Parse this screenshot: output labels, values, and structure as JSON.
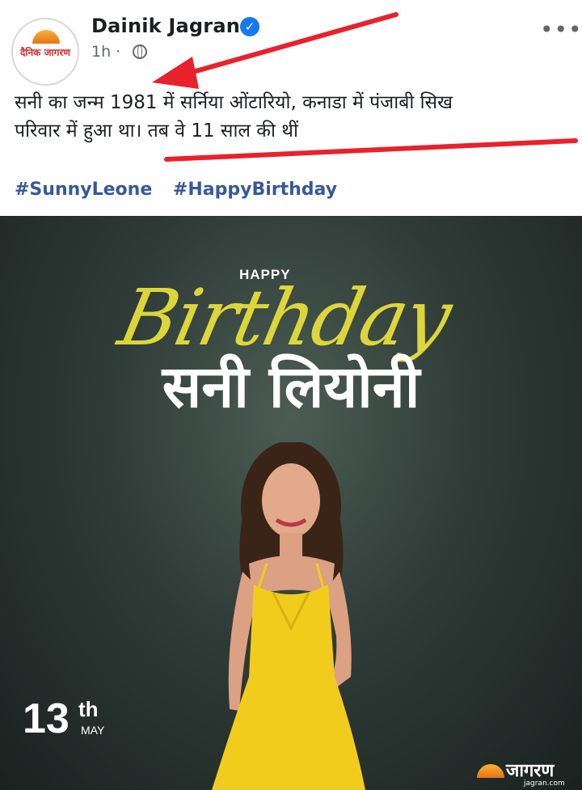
{
  "header": {
    "page_name": "Dainik Jagran",
    "verified_icon": "verified-check-icon",
    "time": "1h ·",
    "privacy_icon": "globe-icon",
    "more_label": "•••",
    "avatar_text": "दैनिक जागरण"
  },
  "post": {
    "text_line1": "सनी का जन्म 1981 में सर्निया ओंटारियो, कनाडा में पंजाबी सिख",
    "text_line2": "परिवार में हुआ था। तब वे 11 साल की थीं",
    "hashtags": [
      "#SunnyLeone",
      "#HappyBirthday"
    ]
  },
  "image": {
    "happy": "HAPPY",
    "birthday": "Birthday",
    "name_hindi": "सनी लियोनी",
    "date_day": "13",
    "date_suffix": "th",
    "date_month": "MAY",
    "brand_name": "जागरण",
    "brand_url": "jagran.com"
  },
  "colors": {
    "hashtag": "#385898",
    "verified": "#1877f2",
    "annotation": "#e8222c",
    "birthday_script": "#e6de3a",
    "dress": "#f2cc1c"
  }
}
